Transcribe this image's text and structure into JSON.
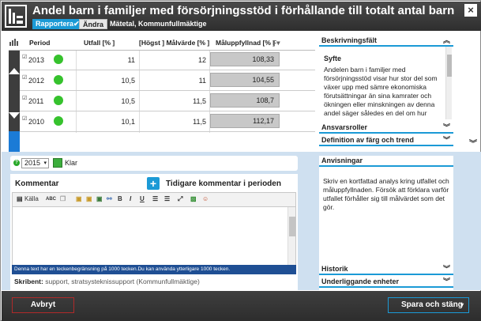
{
  "header": {
    "title": "Andel barn i familjer med försörjningsstöd i förhållande till totalt antal barn",
    "report_label": "Rapportera✔",
    "change_label": "Ändra",
    "meta": "Mätetal, Kommunfullmäktige",
    "close": "×"
  },
  "table": {
    "columns": {
      "period": "Period",
      "utfall": "Utfall [% ]",
      "malvarde": "[Högst ] Målvärde [% ]",
      "maluppfyllnad": "Måluppfyllnad [% ]",
      "sort": "F▾"
    },
    "rows": [
      {
        "check": "☑",
        "year": "2013",
        "utfall": "11",
        "malvarde": "12",
        "maluppfyllnad": "108,33"
      },
      {
        "check": "☑",
        "year": "2012",
        "utfall": "10,5",
        "malvarde": "11",
        "maluppfyllnad": "104,55"
      },
      {
        "check": "☑",
        "year": "2011",
        "utfall": "10,5",
        "malvarde": "11,5",
        "maluppfyllnad": "108,7"
      },
      {
        "check": "☑",
        "year": "2010",
        "utfall": "10,1",
        "malvarde": "11,5",
        "maluppfyllnad": "112,17"
      }
    ]
  },
  "right_panel": {
    "beskrivning": "Beskrivningsfält",
    "syfte_title": "Syfte",
    "syfte_text": "Andelen barn i familjer med försörjningsstöd visar hur stor del som växer upp med sämre ekonomiska förutsättningar än sina kamrater och ökningen eller minskningen av denna andel säger således en del om hur",
    "ansvarsroller": "Ansvarsroller",
    "definition": "Definition av färg och trend",
    "anvisningar": "Anvisningar",
    "anvisningar_text": "Skriv en kortfattad analys kring utfallet och måluppfyllnaden. Försök att förklara varför utfallet förhåller sig till målvärdet som det gör.",
    "historik": "Historik",
    "underliggande": "Underliggande enheter",
    "chev_up": "︽",
    "chev_down": "︾"
  },
  "comment": {
    "help": "?",
    "year_value": "2015",
    "done_label": "Klar",
    "title": "Kommentar",
    "add": "+",
    "previous_title": "Tidigare kommentar i perioden",
    "toolbar": {
      "source": "Källa",
      "spell": "ABC",
      "bold": "B",
      "italic": "I",
      "underline": "U"
    },
    "limit_text": "Denna text har en teckenbegränsning på 1000 tecken.Du kan använda ytterligare 1000 tecken.",
    "author_label": "Skribent:",
    "author_value": "support, stratsystekniss­upport (Kommunfullmäktige)"
  },
  "footer": {
    "cancel": "Avbryt",
    "save": "Spara och stäng",
    "save_caret": "▾"
  },
  "colors": {
    "accent": "#1b9ad6",
    "header_bg": "#3a3a3a",
    "status_green": "#36c22d",
    "cancel_border": "#b02a2a",
    "bottom_bg": "#cfe0f0"
  }
}
